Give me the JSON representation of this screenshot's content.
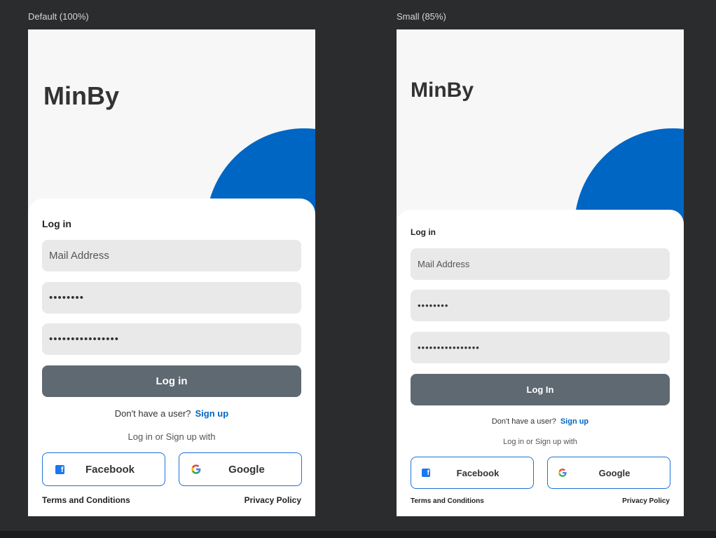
{
  "colors": {
    "canvas_background": "#2b2c2e",
    "brand_blue": "#0066c4",
    "login_button": "#5f6972",
    "link_blue": "#0066c4",
    "facebook_blue": "#1877f2",
    "social_border": "#1d72d6"
  },
  "frames": [
    {
      "label": "Default (100%)",
      "brand": "MinBy",
      "card_title": "Log in",
      "mail_placeholder": "Mail Address",
      "password_masked": "••••••••",
      "confirm_masked": "••••••••••••••••",
      "login_button": "Log in",
      "no_user_text": "Don't have a user?",
      "signup_link": "Sign up",
      "social_prompt": "Log in or Sign up with",
      "facebook_icon": "facebook-icon",
      "facebook_label": "Facebook",
      "google_icon": "google-icon",
      "google_label": "Google",
      "terms_link": "Terms and Conditions",
      "privacy_link": "Privacy Policy"
    },
    {
      "label": "Small (85%)",
      "brand": "MinBy",
      "card_title": "Log in",
      "mail_placeholder": "Mail Address",
      "password_masked": "••••••••",
      "confirm_masked": "••••••••••••••••",
      "login_button": "Log In",
      "no_user_text": "Don't have a user?",
      "signup_link": "Sign up",
      "social_prompt": "Log in or Sign up with",
      "facebook_icon": "facebook-icon",
      "facebook_label": "Facebook",
      "google_icon": "google-icon",
      "google_label": "Google",
      "terms_link": "Terms and Conditions",
      "privacy_link": "Privacy Policy"
    }
  ]
}
